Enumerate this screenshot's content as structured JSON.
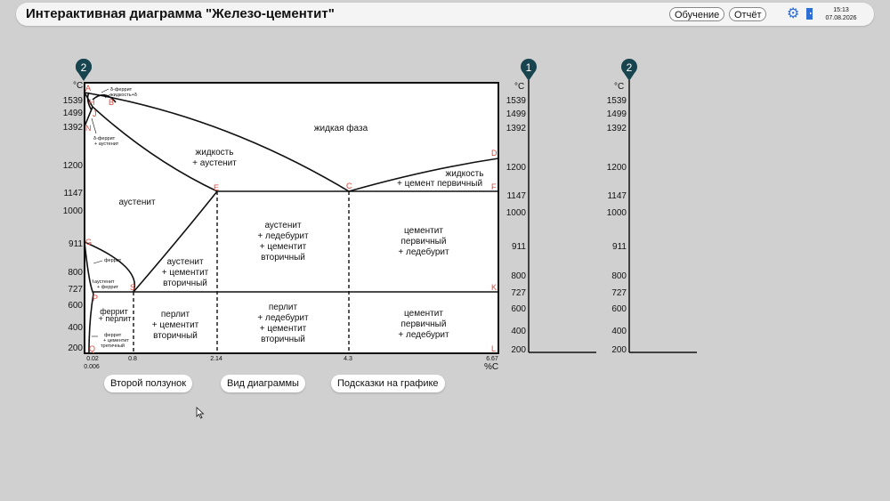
{
  "header": {
    "title": "Интерактивная диаграмма \"Железо-цементит\"",
    "learn_label": "Обучение",
    "report_label": "Отчёт",
    "time": "15:13",
    "date": "07.08.2026"
  },
  "icons": {
    "settings": "gear-icon",
    "exit": "door-icon",
    "pin": "map-pin-icon",
    "cursor": "arrow-cursor-icon"
  },
  "colors": {
    "pin": "#17444e",
    "points": "#e0453a",
    "settings": "#2d6fd2",
    "background": "#d0d0d0"
  },
  "diagram": {
    "pin_label": "2",
    "unit_t": "°C",
    "unit_c": "%С",
    "y_ticks": [
      "1539",
      "1499",
      "1392",
      "1200",
      "1147",
      "1000",
      "911",
      "800",
      "727",
      "600",
      "400",
      "200"
    ],
    "x_ticks": [
      "0.02",
      "0.8",
      "2.14",
      "4.3",
      "6.67"
    ],
    "x_tick_extra": "0.006",
    "points": [
      "A",
      "H",
      "J",
      "B",
      "N",
      "D",
      "E",
      "C",
      "F",
      "G",
      "S",
      "K",
      "P",
      "Q",
      "L"
    ],
    "regions": {
      "liquid": "жидкая фаза",
      "liquid_aust_1": "жидкость",
      "liquid_aust_2": "+ аустенит",
      "liquid_cem_1": "жидкость",
      "liquid_cem_2": "+ цемент первичный",
      "austenite": "аустенит",
      "aust_led": [
        "аустенит",
        "+ ледебурит",
        "+ цементит",
        "вторичный"
      ],
      "cem_led_hi": [
        "цементит",
        "первичный",
        "+ ледебурит"
      ],
      "aust_cem": [
        "аустенит",
        "+ цементит",
        "вторичный"
      ],
      "ferrite_perlite": [
        "феррит",
        "+ перлит"
      ],
      "perlite_cem": [
        "перлит",
        "+ цементит",
        "вторичный"
      ],
      "perlite_led": [
        "перлит",
        "+ ледебурит",
        "+ цементит",
        "вторичный"
      ],
      "cem_led_lo": [
        "цементит",
        "первичный",
        "+ ледебурит"
      ],
      "delta_ferrite": "δ-феррит",
      "liquid_delta": "жидкость+δ",
      "delta_aust": [
        "δ-феррит",
        "+ аустенит"
      ],
      "ferrite": "феррит",
      "aust_ferrite": [
        "аустенит",
        "+ феррит"
      ],
      "ferrite_cem3": [
        "феррит",
        "+ цементит",
        "третичный"
      ]
    }
  },
  "scale1": {
    "pin_label": "1",
    "unit_t": "°C",
    "ticks": [
      "1539",
      "1499",
      "1392",
      "1200",
      "1147",
      "1000",
      "911",
      "800",
      "727",
      "600",
      "400",
      "200"
    ]
  },
  "scale2": {
    "pin_label": "2",
    "unit_t": "°C",
    "ticks": [
      "1539",
      "1499",
      "1392",
      "1200",
      "1147",
      "1000",
      "911",
      "800",
      "727",
      "600",
      "400",
      "200"
    ]
  },
  "buttons": {
    "second_slider": "Второй ползунок",
    "diagram_view": "Вид диаграммы",
    "hints": "Подсказки на графике"
  }
}
